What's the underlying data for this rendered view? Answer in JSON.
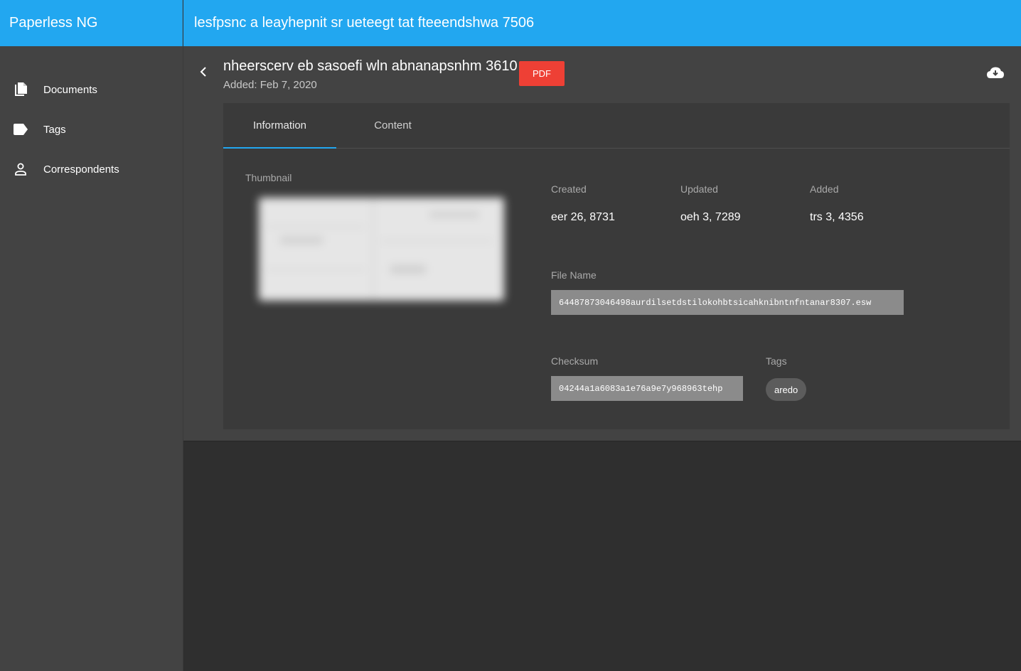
{
  "app": {
    "brand": "Paperless NG",
    "topbar_title": "lesfpsnc a leayhepnit sr ueteegt tat fteeendshwa 7506"
  },
  "sidebar": {
    "items": [
      {
        "label": "Documents",
        "icon": "documents-icon"
      },
      {
        "label": "Tags",
        "icon": "tag-icon"
      },
      {
        "label": "Correspondents",
        "icon": "person-icon"
      }
    ]
  },
  "document": {
    "title": "nheerscerv eb sasoefi wln abnanapsnhm 3610",
    "added_text": "Added: Feb 7, 2020",
    "type_badge": "PDF",
    "badge_color": "#ee4035"
  },
  "tabs": [
    {
      "label": "Information",
      "active": true
    },
    {
      "label": "Content",
      "active": false
    }
  ],
  "info": {
    "thumbnail_label": "Thumbnail",
    "created_label": "Created",
    "created_value": "eer 26, 8731",
    "updated_label": "Updated",
    "updated_value": "oeh 3, 7289",
    "added_label": "Added",
    "added_value": "trs 3, 4356",
    "filename_label": "File Name",
    "filename_value": "64487873046498aurdilsetdstilokohbtsicahknibntnfntanar8307.esw",
    "checksum_label": "Checksum",
    "checksum_value": "04244a1a6083a1e76a9e7y968963tehp",
    "tags_label": "Tags",
    "tags": [
      "aredo"
    ]
  },
  "colors": {
    "accent": "#22a7f0",
    "sidebar_bg": "#434343",
    "content_bg": "#2f2f2f"
  }
}
